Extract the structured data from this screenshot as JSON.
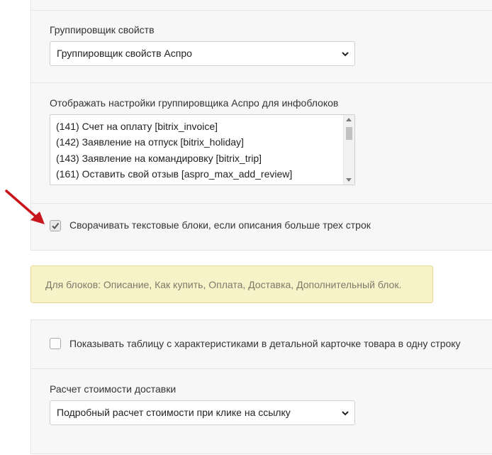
{
  "section_top": {
    "grouper_label": "Группировщик свойств",
    "grouper_value": "Группировщик свойств Аспро",
    "iblocks_label": "Отображать настройки группировщика Аспро для инфоблоков",
    "iblocks_options": [
      "(141) Счет на оплату [bitrix_invoice]",
      "(142) Заявление на отпуск [bitrix_holiday]",
      "(143) Заявление на командировку [bitrix_trip]",
      "(161) Оставить свой отзыв [aspro_max_add_review]"
    ],
    "collapse_checkbox_label": "Сворачивать текстовые блоки, если описания больше трех строк",
    "collapse_checked": true
  },
  "note": {
    "text": "Для блоков: Описание, Как купить, Оплата, Доставка, Дополнительный блок."
  },
  "section_bottom": {
    "table_checkbox_label": "Показывать таблицу с характеристиками в детальной карточке товара в одну строку",
    "table_checked": false,
    "delivery_label": "Расчет стоимости доставки",
    "delivery_value": "Подробный расчет стоимости при клике на ссылку"
  },
  "colors": {
    "panel_bg": "#f7f7f7",
    "note_bg": "#f8f2c9",
    "arrow": "#c8151b"
  },
  "icons": {
    "arrow": "red-arrow-icon",
    "chevron": "chevron-down-icon",
    "check": "check-icon"
  }
}
